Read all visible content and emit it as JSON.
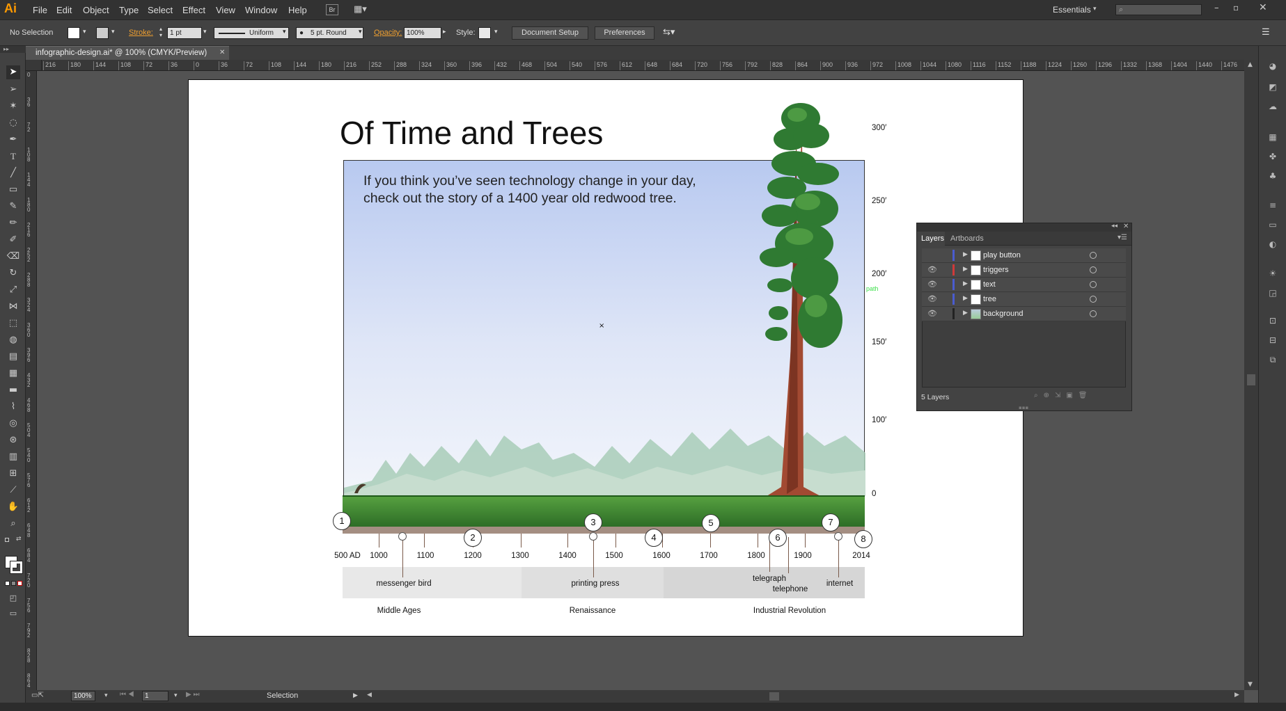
{
  "app": {
    "logo": "Ai",
    "workspace": "Essentials"
  },
  "menu": [
    "File",
    "Edit",
    "Object",
    "Type",
    "Select",
    "Effect",
    "View",
    "Window",
    "Help"
  ],
  "menu_extra": {
    "bridge": "Br"
  },
  "control": {
    "selection": "No Selection",
    "stroke_label": "Stroke:",
    "stroke_value": "1 pt",
    "profile": "Uniform",
    "brush": "5 pt. Round",
    "opacity_label": "Opacity:",
    "opacity_value": "100%",
    "style_label": "Style:",
    "doc_setup": "Document Setup",
    "preferences": "Preferences"
  },
  "document": {
    "tab_title": "infographic-design.ai* @ 100% (CMYK/Preview)"
  },
  "ruler": {
    "h_ticks": [
      "216",
      "180",
      "144",
      "108",
      "72",
      "36",
      "0",
      "36",
      "72",
      "108",
      "144",
      "180",
      "216",
      "252",
      "288",
      "324",
      "360",
      "396",
      "432",
      "468",
      "504",
      "540",
      "576",
      "612",
      "648",
      "684",
      "720",
      "756",
      "792",
      "828",
      "864",
      "900",
      "936",
      "972",
      "1008",
      "1044",
      "1080",
      "1116",
      "1152",
      "1188",
      "1224",
      "1260",
      "1296",
      "1332",
      "1368",
      "1404",
      "1440",
      "1476"
    ],
    "v_ticks": [
      "0",
      "36",
      "72",
      "108",
      "144",
      "180",
      "216",
      "252",
      "288",
      "324",
      "360",
      "396",
      "432",
      "468",
      "504",
      "540",
      "576",
      "612",
      "648",
      "684",
      "720",
      "756",
      "792",
      "828",
      "864"
    ]
  },
  "status": {
    "zoom": "100%",
    "artboard": "1",
    "tool": "Selection"
  },
  "infographic": {
    "title": "Of Time and Trees",
    "subtitle_line1": "If you think you’ve seen technology change in your day,",
    "subtitle_line2": "check out the story of a 1400 year old redwood tree.",
    "heights": [
      "300′",
      "250′",
      "200′",
      "150′",
      "100′",
      "0"
    ],
    "path_hint": "path",
    "years": [
      "500 AD",
      "1000",
      "1100",
      "1200",
      "1300",
      "1400",
      "1500",
      "1600",
      "1700",
      "1800",
      "1900",
      "2014"
    ],
    "markers": [
      "1",
      "2",
      "3",
      "4",
      "5",
      "6",
      "7",
      "8"
    ],
    "events": {
      "bird": "messenger bird",
      "press": "printing press",
      "telegraph": "telegraph",
      "telephone": "telephone",
      "internet": "internet"
    },
    "eras": {
      "middle": "Middle Ages",
      "renaissance": "Renaissance",
      "industrial": "Industrial Revolution"
    }
  },
  "layers_panel": {
    "tabs": [
      "Layers",
      "Artboards"
    ],
    "layers": [
      {
        "name": "play button",
        "color": "#4a5cd0",
        "visible": false
      },
      {
        "name": "triggers",
        "color": "#d03a3a",
        "visible": true
      },
      {
        "name": "text",
        "color": "#4a5cd0",
        "visible": true
      },
      {
        "name": "tree",
        "color": "#4a5cd0",
        "visible": true
      },
      {
        "name": "background",
        "color": "#222222",
        "visible": true
      }
    ],
    "footer": "5 Layers"
  }
}
